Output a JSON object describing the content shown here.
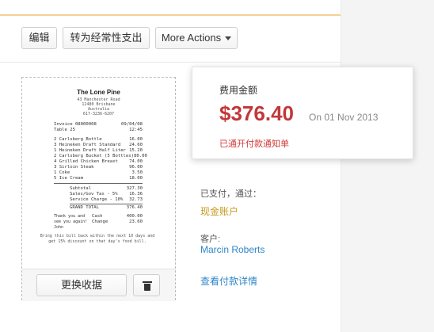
{
  "toolbar": {
    "edit_label": "编辑",
    "convert_label": "转为经常性支出",
    "more_label": "More Actions"
  },
  "receipt": {
    "title": "The Lone Pine",
    "address": [
      "43 Manchester Road",
      "12480 Brisbane",
      "Australia",
      "617-3236-6207"
    ],
    "invoice_label": "Invoice 08000008",
    "invoice_date": "09/04/08",
    "table_label": "Table   25",
    "table_time": "12:45",
    "items": [
      {
        "name": "2 Carlsberg Bottle",
        "price": "16.00"
      },
      {
        "name": "3 Heineken Draft Standard",
        "price": "24.60"
      },
      {
        "name": "1 Heineken Draft Half Liter",
        "price": "15.20"
      },
      {
        "name": "2 Carlsberg Bucket (5 Bottles)",
        "price": "80.00"
      },
      {
        "name": "4 Grilled Chicken Breast",
        "price": "74.00"
      },
      {
        "name": "3 Sirloin Steak",
        "price": "96.00"
      },
      {
        "name": "1 Coke",
        "price": "3.50"
      },
      {
        "name": "5 Ice Cream",
        "price": "18.00"
      }
    ],
    "totals": [
      {
        "name": "Subtotal",
        "price": "327.30"
      },
      {
        "name": "Sales/Gov Tax - 5%",
        "price": "16.36"
      },
      {
        "name": "Service Charge - 10%",
        "price": "32.73"
      },
      {
        "name": "GRAND TOTAL",
        "price": "376.40"
      }
    ],
    "thanks": "Thank you and see you again!",
    "cashier": "John",
    "cash_label": "Cash",
    "cash_value": "400.00",
    "change_label": "Change",
    "change_value": "23.60",
    "footer": "Bring this bill back within the next 10 days and get 15% discount on that day's food bill.",
    "replace_label": "更换收据"
  },
  "popup": {
    "title": "费用金额",
    "amount": "$376.40",
    "date": "On 01 Nov 2013",
    "note": "已通开付款通知单"
  },
  "details": {
    "paid_label": "已支付，通过：",
    "paid_value": "现金账户",
    "customer_label": "客户:",
    "customer_value": "Marcin Roberts",
    "view_link": "查看付款详情"
  },
  "colors": {
    "accent_amount": "#c2383a",
    "link": "#2f86c8",
    "account": "#c79a1e",
    "note": "#d23a3a"
  }
}
